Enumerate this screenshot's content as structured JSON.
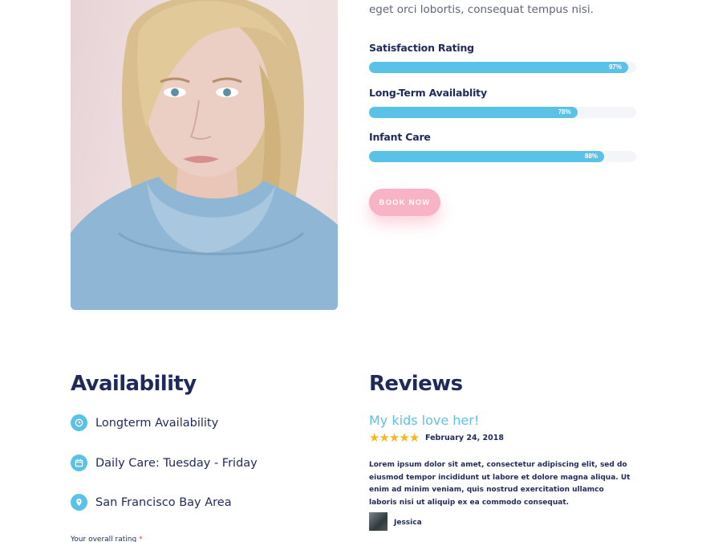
{
  "intro": {
    "tail_text": "eget orci lobortis, consequat tempus nisi."
  },
  "skills": [
    {
      "label": "Satisfaction Rating",
      "percent_text": "97%",
      "level": 0.97
    },
    {
      "label": "Long-Term Availablity",
      "percent_text": "78%",
      "level": 0.78
    },
    {
      "label": "Infant Care",
      "percent_text": "88%",
      "level": 0.88
    }
  ],
  "book_button": {
    "label": "BOOK NOW"
  },
  "availability": {
    "heading": "Availability",
    "items": [
      {
        "icon": "clock-icon",
        "text": "Longterm Availability"
      },
      {
        "icon": "calendar-icon",
        "text": "Daily Care: Tuesday - Friday"
      },
      {
        "icon": "location-pin-icon",
        "text": "San Francisco Bay Area"
      }
    ],
    "rating_label": "Your overall rating",
    "required_mark": "*"
  },
  "reviews": {
    "heading": "Reviews",
    "items": [
      {
        "title": "My kids love her!",
        "stars": 5,
        "date": "February 24, 2018",
        "body": "Lorem ipsum dolor sit amet, consectetur adipiscing elit, sed do eiusmod tempor incididunt ut labore et dolore magna aliqua. Ut enim ad minim veniam, quis nostrud exercitation ullamco laboris nisi ut aliquip ex ea commodo consequat.",
        "author": "Jessica"
      }
    ]
  },
  "colors": {
    "accent_blue": "#5bc2e7",
    "accent_pink": "#f9b3c6",
    "heading_navy": "#1f2a5a",
    "star_gold": "#f5b919"
  }
}
